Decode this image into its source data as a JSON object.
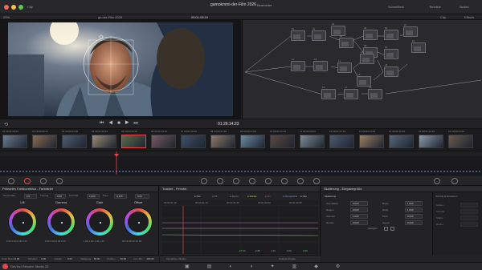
{
  "window": {
    "title": "gamokmmi-der-Film 2026",
    "subtitle": "Bearbeitet"
  },
  "menu": {
    "app": "Clip",
    "zoom": "29%",
    "clip_name": "gk-der-Film 2026",
    "tc_top": "00:01:08:19"
  },
  "topright": {
    "items": [
      "Schnelltest",
      "Timeline",
      "Nodes"
    ],
    "clip_mode": "Clip",
    "right_btn": "Effects"
  },
  "viewer": {
    "timecode": "01:26:14:23"
  },
  "clips": [
    {
      "n": "01",
      "tc": "00:01:05:04"
    },
    {
      "n": "02",
      "tc": "00:00:09:27"
    },
    {
      "n": "03",
      "tc": "00:00:04:06"
    },
    {
      "n": "04",
      "tc": "00:02:20:04"
    },
    {
      "n": "05",
      "tc": "00:00:12:20"
    },
    {
      "n": "06",
      "tc": "00:02:13:16"
    },
    {
      "n": "07",
      "tc": "00:00:18:00"
    },
    {
      "n": "08",
      "tc": "00:00:22:28"
    },
    {
      "n": "09",
      "tc": "00:03:37:06"
    },
    {
      "n": "10",
      "tc": "00:00:12:26"
    },
    {
      "n": "11",
      "tc": "00:00:20:03"
    },
    {
      "n": "12",
      "tc": "00:01:27:19"
    },
    {
      "n": "13",
      "tc": "00:00:14:08"
    },
    {
      "n": "14",
      "tc": "00:00:12:09"
    },
    {
      "n": "15",
      "tc": "00:01:12:26"
    },
    {
      "n": "16",
      "tc": "00:00:04:00"
    }
  ],
  "primaries": {
    "title": "Primaries Farbkorrektur - Farbräder",
    "temperature": "0.0",
    "tint": "0.00",
    "contrast": "1.000",
    "pivot": "0.435",
    "mid_detail": "0.00",
    "wheels": [
      {
        "name": "Lift",
        "vals": [
          "0.00",
          "0.00",
          "0.00",
          "0.00"
        ]
      },
      {
        "name": "Gamma",
        "vals": [
          "0.00",
          "0.00",
          "0.00",
          "0.00"
        ]
      },
      {
        "name": "Gain",
        "vals": [
          "1.00",
          "1.00",
          "1.00",
          "1.00"
        ]
      },
      {
        "name": "Offset",
        "vals": [
          "25.00",
          "25.00",
          "25.00"
        ]
      }
    ],
    "footer": [
      "Color Boost",
      "0.00",
      "Schatten",
      "0.00",
      "Lichter",
      "0.00",
      "Sättigung",
      "50.00",
      "Farbton",
      "50.00",
      "Lum Mix",
      "100.00"
    ]
  },
  "tracker": {
    "title": "Tracker - Fenster",
    "controls": [
      "Pan",
      "Tilt",
      "Zoom",
      "Rotate",
      "3D",
      "Perspective",
      "Clip"
    ],
    "ruler": [
      "00:01:01:10",
      "00:01:01:15",
      "00:01:01:20",
      "00:01:02:00",
      "00:01:02:05"
    ],
    "footer_left": "Interaktiver Modus",
    "footer_right": "Analyse-Punkte",
    "values": [
      "-27.64",
      "-2.85",
      "1.00",
      "0.00",
      "0.00"
    ]
  },
  "sizing": {
    "title": "Skalierung - Eingabegröße",
    "section": "Skalierung",
    "left_rows": [
      {
        "l": "Zoomfaktor",
        "v": "0.000"
      },
      {
        "l": "Neigen",
        "v": "0.000"
      },
      {
        "l": "Zoomen",
        "v": "1.000"
      },
      {
        "l": "Drehen",
        "v": "0.000"
      }
    ],
    "right_rows": [
      {
        "l": "Breite",
        "v": "1.000"
      },
      {
        "l": "Höhe",
        "v": "1.000"
      },
      {
        "l": "Pitch",
        "v": "0.000"
      },
      {
        "l": "Gieren",
        "v": "0.000"
      }
    ],
    "flip_label": "Spiegeln",
    "side_title": "Schärfe & Rauschen",
    "side_rows": [
      "Glätten",
      "Schärfe",
      "Stärke",
      "Radius"
    ]
  },
  "status": {
    "app": "DaVinci Resolve Studio 20"
  },
  "colors": {
    "accent": "#e0474c",
    "bg": "#1e1e21"
  }
}
